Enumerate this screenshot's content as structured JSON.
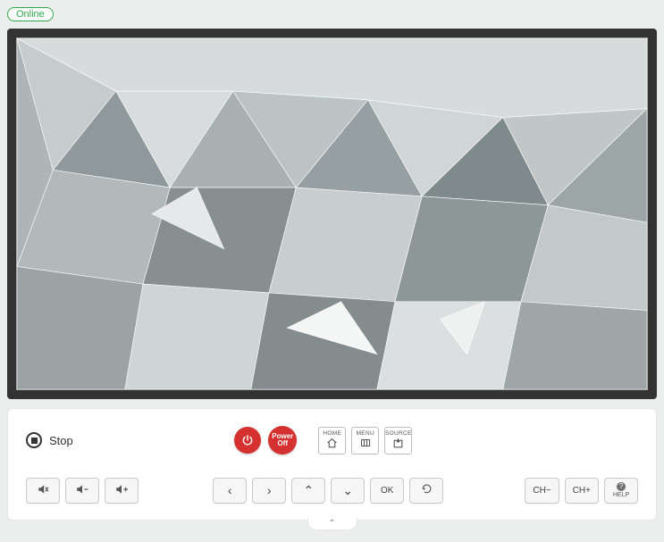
{
  "status": {
    "label": "Online"
  },
  "playback": {
    "stop_label": "Stop"
  },
  "power": {
    "power_off_line1": "Power",
    "power_off_line2": "Off"
  },
  "top_buttons": {
    "home": {
      "label": "HOME"
    },
    "menu": {
      "label": "MENU"
    },
    "source": {
      "label": "SOURCE"
    }
  },
  "nav": {
    "ok_label": "OK"
  },
  "channels": {
    "down_label": "CH−",
    "up_label": "CH+"
  },
  "help": {
    "label": "HELP"
  }
}
